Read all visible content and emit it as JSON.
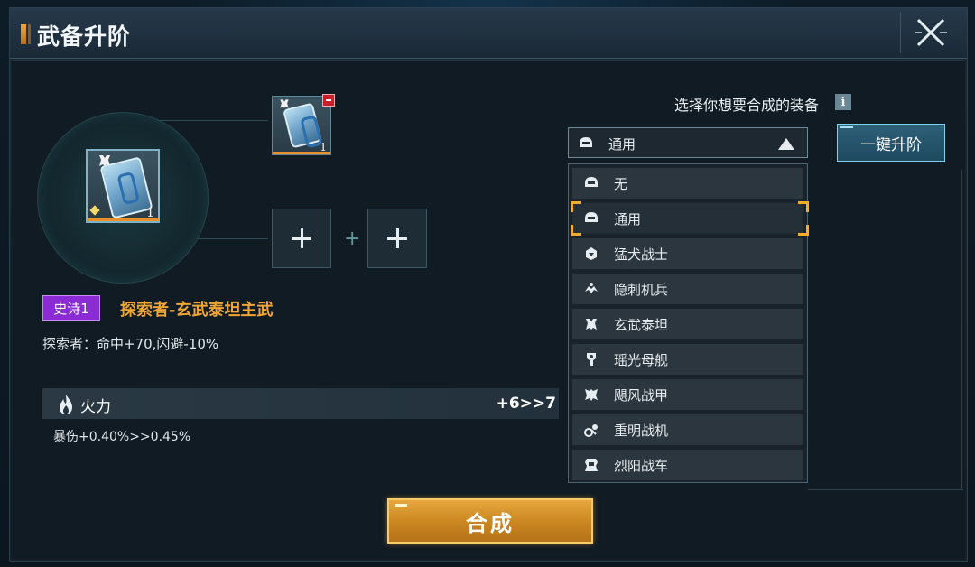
{
  "window": {
    "title": "武备升阶"
  },
  "item": {
    "main_slot_quantity": "1",
    "material_slot_quantity": "1",
    "rarity": "史诗1",
    "name": "探索者-玄武泰坦主武",
    "description": "探索者：命中+70,闪避-10%"
  },
  "stat": {
    "icon": "flame-icon",
    "label": "火力",
    "value": "+6>>7",
    "detail": "暴伤+0.40%>>0.45%"
  },
  "selector": {
    "title": "选择你想要合成的装备",
    "info_label": "i",
    "selected": "通用",
    "upgrade_button": "一键升阶",
    "options": [
      {
        "label": "无",
        "icon": "helmet-icon"
      },
      {
        "label": "通用",
        "icon": "helmet-icon",
        "selected": true
      },
      {
        "label": "猛犬战士",
        "icon": "dog-helmet-icon"
      },
      {
        "label": "隐刺机兵",
        "icon": "stealth-icon"
      },
      {
        "label": "玄武泰坦",
        "icon": "titan-icon"
      },
      {
        "label": "瑶光母舰",
        "icon": "mothership-icon"
      },
      {
        "label": "飓风战甲",
        "icon": "armor-icon"
      },
      {
        "label": "重明战机",
        "icon": "fighter-icon"
      },
      {
        "label": "烈阳战车",
        "icon": "tank-icon"
      }
    ]
  },
  "actions": {
    "synthesize": "合成"
  },
  "colors": {
    "accent_orange": "#f0a534",
    "rarity_purple": "#8a2bd4",
    "upgrade_blue": "#2d6078"
  }
}
